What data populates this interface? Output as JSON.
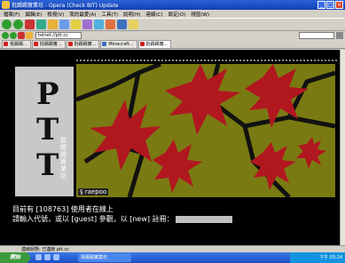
{
  "window": {
    "title": "批踢踢實業坊 - Opera (Check BIT) Update"
  },
  "menu": [
    "檔案(F)",
    "編輯(E)",
    "檢視(V)",
    "我的最愛(A)",
    "工具(T)",
    "說明(H)",
    "連線(C)",
    "設定(O)",
    "視窗(W)"
  ],
  "address": {
    "label": "網址",
    "value": "telnet://ptt.cc"
  },
  "tabs": [
    {
      "label": "批踢踢...",
      "active": false
    },
    {
      "label": "批踢踢實...",
      "active": false
    },
    {
      "label": "批踢踢實...",
      "active": false
    },
    {
      "label": "Minecraft...",
      "active": false
    },
    {
      "label": "批踢踢實...",
      "active": true
    }
  ],
  "screen": {
    "vertical_text": "批踢踢實業坊",
    "author": "§ raepoo",
    "online_line": "目前有 [108763] 使用者在線上",
    "login_prompt": "請輸入代號，或以 [guest] 參觀，以 [new] 註冊："
  },
  "status": {
    "text": "連線狀態: 已連線 ptt.cc"
  },
  "taskbar": {
    "start": "開始",
    "active_window": "批踢踢實業坊",
    "clock": "下午 03:14"
  },
  "colors": {
    "bg": "#000000",
    "art_bg": "#7a7a12",
    "leaf": "#b0171f"
  }
}
